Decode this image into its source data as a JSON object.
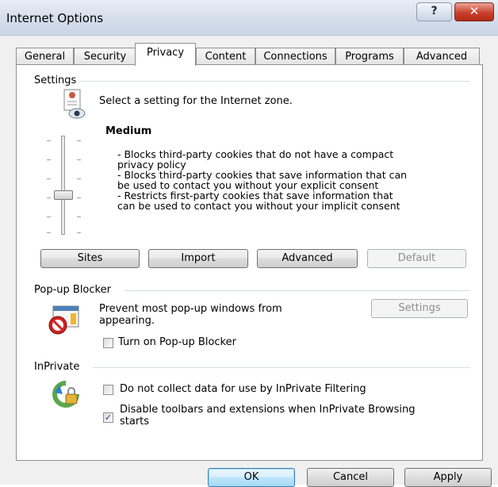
{
  "window": {
    "title": "Internet Options",
    "help_glyph": "?",
    "close_glyph": "✕"
  },
  "tabs": [
    {
      "label": "General"
    },
    {
      "label": "Security"
    },
    {
      "label": "Privacy"
    },
    {
      "label": "Content"
    },
    {
      "label": "Connections"
    },
    {
      "label": "Programs"
    },
    {
      "label": "Advanced"
    }
  ],
  "active_tab": "Privacy",
  "settings": {
    "group_label": "Settings",
    "zone_text": "Select a setting for the Internet zone.",
    "level_title": "Medium",
    "description": [
      "- Blocks third-party cookies that do not have a compact",
      "privacy policy",
      "- Blocks third-party cookies that save information that can",
      "be used to contact you without your explicit consent",
      "- Restricts first-party cookies that save information that",
      "can be used to contact you without your implicit consent"
    ],
    "buttons": {
      "sites": "Sites",
      "import": "Import",
      "advanced": "Advanced",
      "default": "Default"
    }
  },
  "popup": {
    "group_label": "Pop-up Blocker",
    "text_line1": "Prevent most pop-up windows from",
    "text_line2": "appearing.",
    "settings_button": "Settings",
    "checkbox_label": "Turn on Pop-up Blocker",
    "checked": false
  },
  "inprivate": {
    "group_label": "InPrivate",
    "filter_label": "Do not collect data for use by InPrivate Filtering",
    "filter_checked": false,
    "toolbars_label_line1": "Disable toolbars and extensions when InPrivate Browsing",
    "toolbars_label_line2": "starts",
    "toolbars_checked": true,
    "check_glyph": "✓"
  },
  "footer": {
    "ok": "OK",
    "cancel": "Cancel",
    "apply": "Apply"
  },
  "colors": {
    "title_bar": "#d7e0ec",
    "close_button": "#c9402b",
    "ok_focus": "#3c7fb1"
  }
}
